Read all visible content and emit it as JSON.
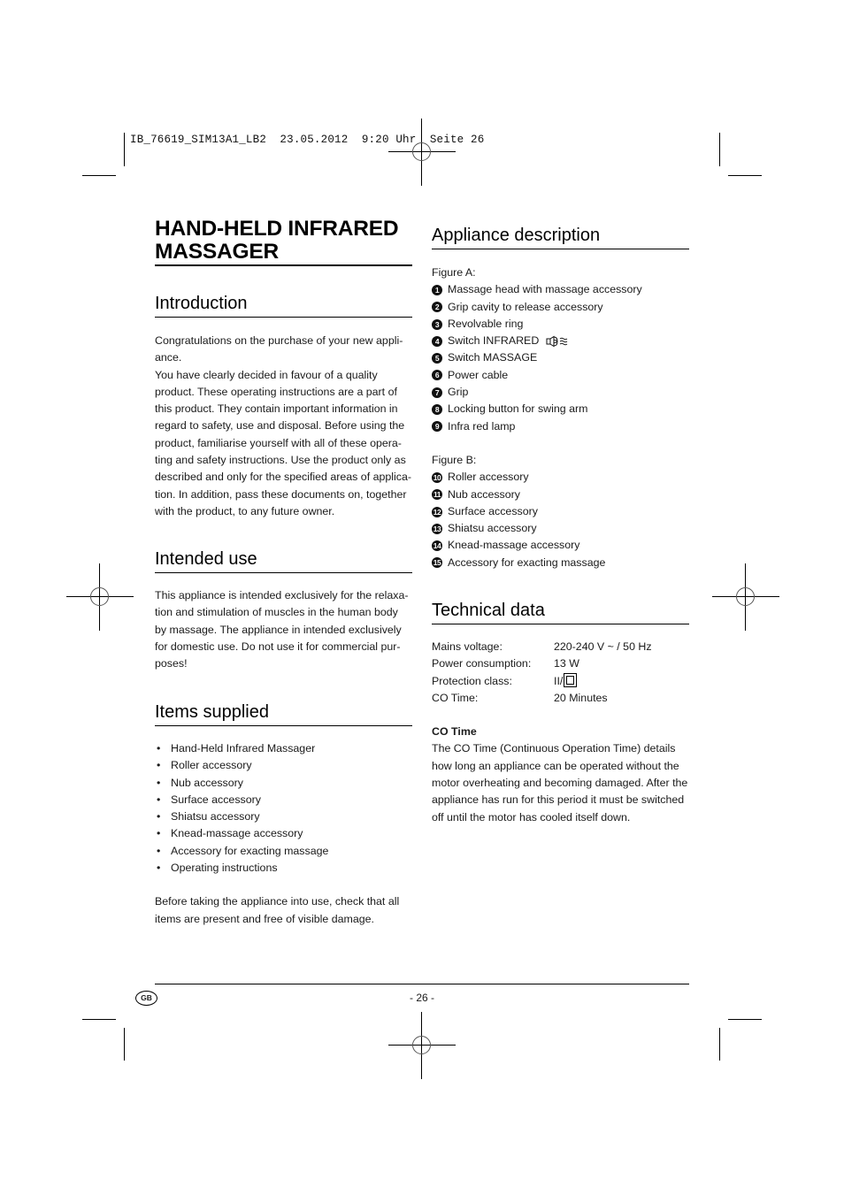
{
  "print_slug": "IB_76619_SIM13A1_LB2  23.05.2012  9:20 Uhr  Seite 26",
  "title_line1": "HAND-HELD INFRARED",
  "title_line2": "MASSAGER",
  "introduction": {
    "heading": "Introduction",
    "paragraphs": [
      "Congratulations on the purchase of your new appli-ance.",
      "You have clearly decided in favour of a quality product. These operating instructions are a part of this product. They contain important information in regard to safety, use and disposal. Before using the product, familiarise yourself with all of these opera-ting and safety instructions. Use the product only as described and only for the specified areas of applica-tion. In addition, pass these documents on, together with the product, to any future owner."
    ]
  },
  "intended_use": {
    "heading": "Intended use",
    "text": "This appliance is intended exclusively for the relaxa-tion and stimulation of muscles in the human body by massage. The appliance in intended exclusively for domestic use. Do not use it for commercial pur-poses!"
  },
  "items_supplied": {
    "heading": "Items supplied",
    "items": [
      "Hand-Held Infrared Massager",
      "Roller accessory",
      "Nub accessory",
      "Surface accessory",
      "Shiatsu accessory",
      "Knead-massage accessory",
      "Accessory for exacting massage",
      "Operating instructions"
    ],
    "note": "Before taking the appliance into use, check that all items are present and free of visible damage."
  },
  "appliance_description": {
    "heading": "Appliance description",
    "figure_a_label": "Figure A:",
    "figure_a": [
      {
        "num": "1",
        "label": "Massage head with massage accessory"
      },
      {
        "num": "2",
        "label": "Grip cavity to release accessory"
      },
      {
        "num": "3",
        "label": "Revolvable ring"
      },
      {
        "num": "4",
        "label": "Switch INFRARED",
        "icon": "infrared-lamp-icon"
      },
      {
        "num": "5",
        "label": "Switch MASSAGE"
      },
      {
        "num": "6",
        "label": "Power cable"
      },
      {
        "num": "7",
        "label": "Grip"
      },
      {
        "num": "8",
        "label": "Locking button for swing arm"
      },
      {
        "num": "9",
        "label": "Infra red lamp"
      }
    ],
    "figure_b_label": "Figure B:",
    "figure_b": [
      {
        "num": "10",
        "label": "Roller accessory"
      },
      {
        "num": "11",
        "label": "Nub accessory"
      },
      {
        "num": "12",
        "label": "Surface accessory"
      },
      {
        "num": "13",
        "label": "Shiatsu accessory"
      },
      {
        "num": "14",
        "label": "Knead-massage accessory"
      },
      {
        "num": "15",
        "label": "Accessory for exacting massage"
      }
    ]
  },
  "technical_data": {
    "heading": "Technical data",
    "specs": [
      {
        "label": "Mains voltage:",
        "value": "220-240 V ~ / 50 Hz"
      },
      {
        "label": "Power consumption:",
        "value": "13 W"
      },
      {
        "label": "Protection class:",
        "value": "II/",
        "icon": "protection-class-ii-icon"
      },
      {
        "label": "CO Time:",
        "value": "20 Minutes"
      }
    ],
    "co_time_heading": "CO Time",
    "co_time_text": "The CO Time (Continuous Operation Time) details how long an appliance can be operated without the motor overheating and becoming damaged. After the appliance has run for this period it must be switched off until the motor has cooled itself down."
  },
  "footer": {
    "country_badge": "GB",
    "page_number": "- 26 -"
  }
}
